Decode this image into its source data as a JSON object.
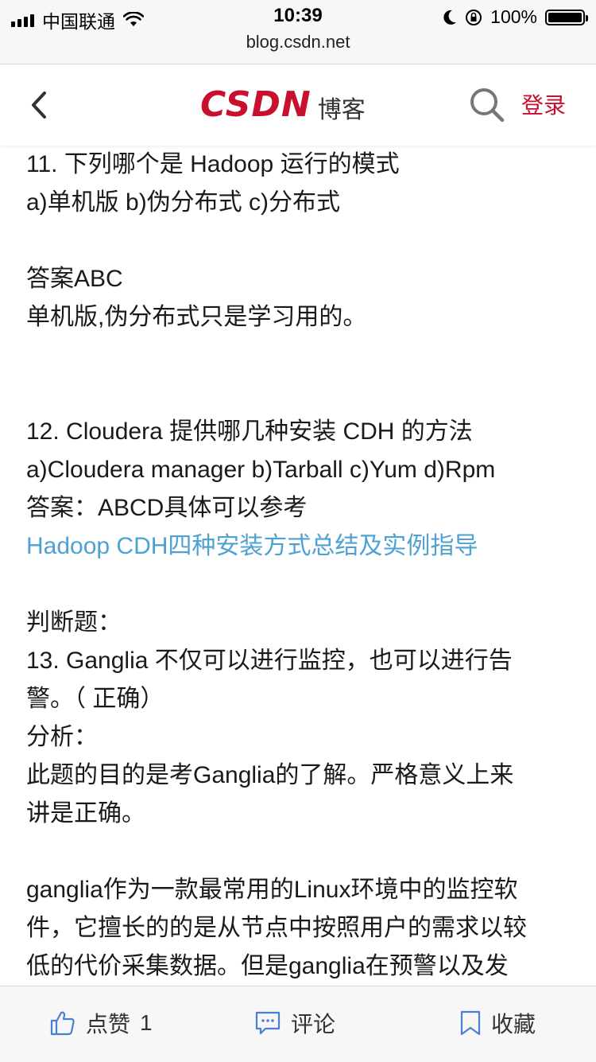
{
  "status_bar": {
    "carrier": "中国联通",
    "time": "10:39",
    "battery": "100%",
    "icons": [
      "signal-icon",
      "wifi-icon",
      "moon-icon",
      "rotation-lock-icon",
      "battery-icon"
    ]
  },
  "url": "blog.csdn.net",
  "header": {
    "brand": "CSDN",
    "brand_sub": "博客",
    "login": "登录",
    "accent": "#c8102e"
  },
  "article": {
    "q11_title": "11. 下列哪个是 Hadoop 运行的模式",
    "q11_options": "a)单机版 b)伪分布式 c)分布式",
    "q11_answer": "答案ABC",
    "q11_note": "单机版,伪分布式只是学习用的。",
    "q12_title": "12. Cloudera 提供哪几种安装 CDH 的方法",
    "q12_options": "a)Cloudera manager b)Tarball c)Yum d)Rpm",
    "q12_answer": "答案：ABCD具体可以参考",
    "q12_link": "Hadoop CDH四种安装方式总结及实例指导",
    "section": "判断题：",
    "q13_line1": "13. Ganglia 不仅可以进行监控，也可以进行告",
    "q13_line2": "警。（ 正确）",
    "analysis": "分析：",
    "analysis_l1": "此题的目的是考Ganglia的了解。严格意义上来",
    "analysis_l2": "讲是正确。",
    "para_l1": "ganglia作为一款最常用的Linux环境中的监控软",
    "para_l2": "件，它擅长的的是从节点中按照用户的需求以较",
    "para_l3": "低的代价采集数据。但是ganglia在预警以及发",
    "link_color": "#4ea1d3"
  },
  "bottom_bar": {
    "like_label": "点赞",
    "like_count": "1",
    "comment_label": "评论",
    "favorite_label": "收藏",
    "icon_color": "#4a7fd6"
  }
}
